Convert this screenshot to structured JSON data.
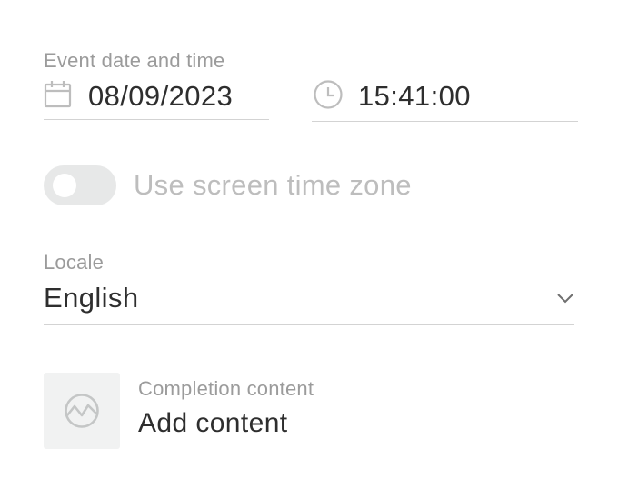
{
  "event": {
    "label": "Event date and time",
    "date_value": "08/09/2023",
    "time_value": "15:41:00",
    "date_icon": "calendar-icon",
    "time_icon": "clock-icon"
  },
  "timezone_toggle": {
    "label": "Use screen time zone",
    "enabled": false
  },
  "locale": {
    "label": "Locale",
    "selected": "English",
    "icon": "chevron-down-icon"
  },
  "completion": {
    "label": "Completion content",
    "action": "Add content",
    "icon": "image-placeholder-icon"
  },
  "colors": {
    "label_grey": "#9b9b9b",
    "value_text": "#2e2e2e",
    "underline": "#d3d3d3",
    "toggle_track": "#e7e8e8",
    "thumb_bg": "#f1f2f2"
  }
}
